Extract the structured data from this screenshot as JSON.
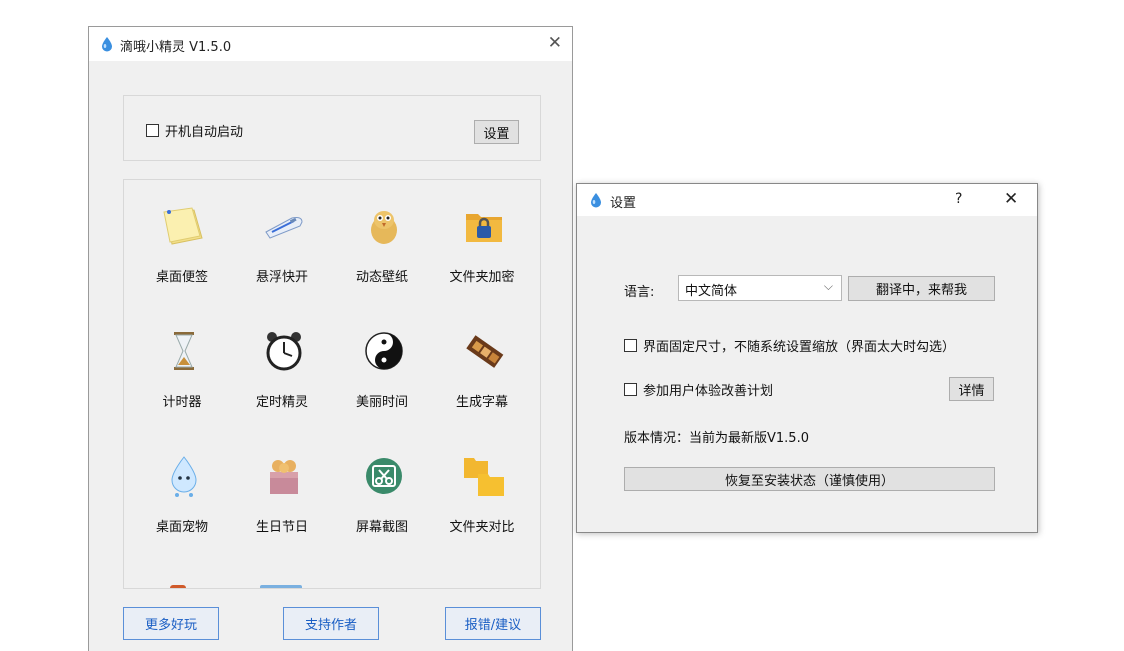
{
  "main_window": {
    "title": "滴哦小精灵 V1.5.0",
    "close_glyph": "✕",
    "autostart_label": "开机自动启动",
    "settings_button": "设置",
    "tools": [
      {
        "label": "桌面便签",
        "icon": "sticky-note-icon"
      },
      {
        "label": "悬浮快开",
        "icon": "bullet-train-icon"
      },
      {
        "label": "动态壁纸",
        "icon": "chick-icon"
      },
      {
        "label": "文件夹加密",
        "icon": "locked-folder-icon"
      },
      {
        "label": "计时器",
        "icon": "hourglass-icon"
      },
      {
        "label": "定时精灵",
        "icon": "alarm-clock-icon"
      },
      {
        "label": "美丽时间",
        "icon": "yin-yang-clock-icon"
      },
      {
        "label": "生成字幕",
        "icon": "film-strip-icon"
      },
      {
        "label": "桌面宠物",
        "icon": "water-drop-pet-icon"
      },
      {
        "label": "生日节日",
        "icon": "gift-box-icon"
      },
      {
        "label": "屏幕截图",
        "icon": "screenshot-scissors-icon"
      },
      {
        "label": "文件夹对比",
        "icon": "compare-folders-icon"
      }
    ],
    "bottom_buttons": {
      "more_fun": "更多好玩",
      "support_author": "支持作者",
      "report_suggest": "报错/建议"
    }
  },
  "settings_dialog": {
    "title": "设置",
    "help_glyph": "?",
    "close_glyph": "✕",
    "language_label": "语言:",
    "language_value": "中文简体",
    "translate_button": "翻译中，来帮我",
    "fixed_size_label": "界面固定尺寸，不随系统设置缩放（界面太大时勾选）",
    "ux_program_label": "参加用户体验改善计划",
    "details_button": "详情",
    "version_status": "版本情况：当前为最新版V1.5.0",
    "restore_button": "恢复至安装状态（谨慎使用）"
  },
  "colors": {
    "window_bg": "#f0f0f0",
    "accent_blue": "#1a5ec4",
    "drop_blue": "#3a8fe0"
  }
}
